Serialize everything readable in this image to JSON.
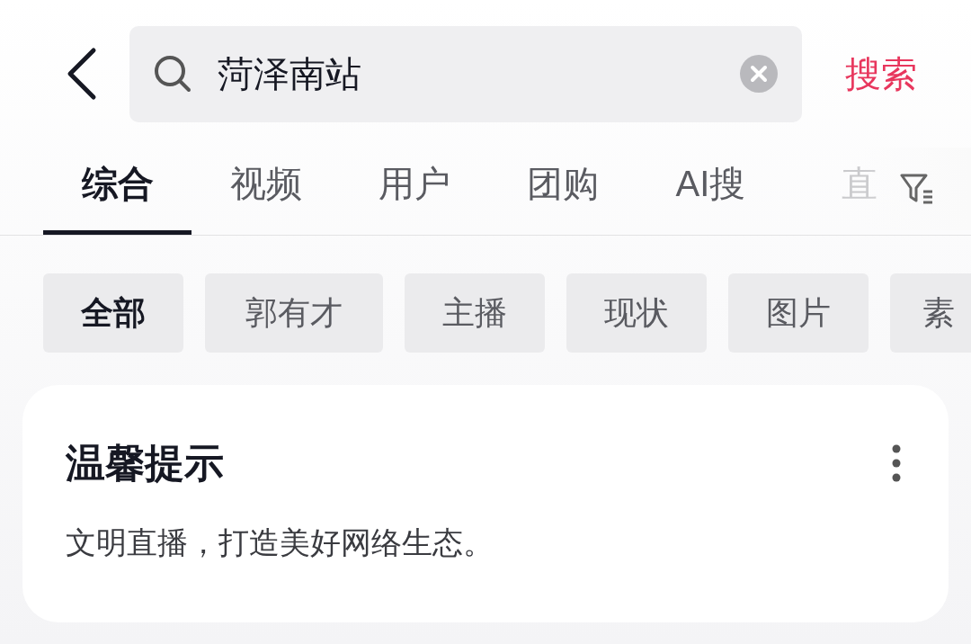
{
  "search": {
    "value": "菏泽南站",
    "submit": "搜索"
  },
  "tabs": [
    {
      "label": "综合",
      "selected": true
    },
    {
      "label": "视频",
      "selected": false
    },
    {
      "label": "用户",
      "selected": false
    },
    {
      "label": "团购",
      "selected": false
    },
    {
      "label": "AI搜",
      "selected": false
    },
    {
      "label": "直",
      "selected": false
    }
  ],
  "chips": [
    {
      "label": "全部",
      "selected": true
    },
    {
      "label": "郭有才",
      "selected": false
    },
    {
      "label": "主播",
      "selected": false
    },
    {
      "label": "现状",
      "selected": false
    },
    {
      "label": "图片",
      "selected": false
    },
    {
      "label": "素",
      "selected": false
    }
  ],
  "notice": {
    "title": "温馨提示",
    "text": "文明直播，打造美好网络生态。"
  }
}
